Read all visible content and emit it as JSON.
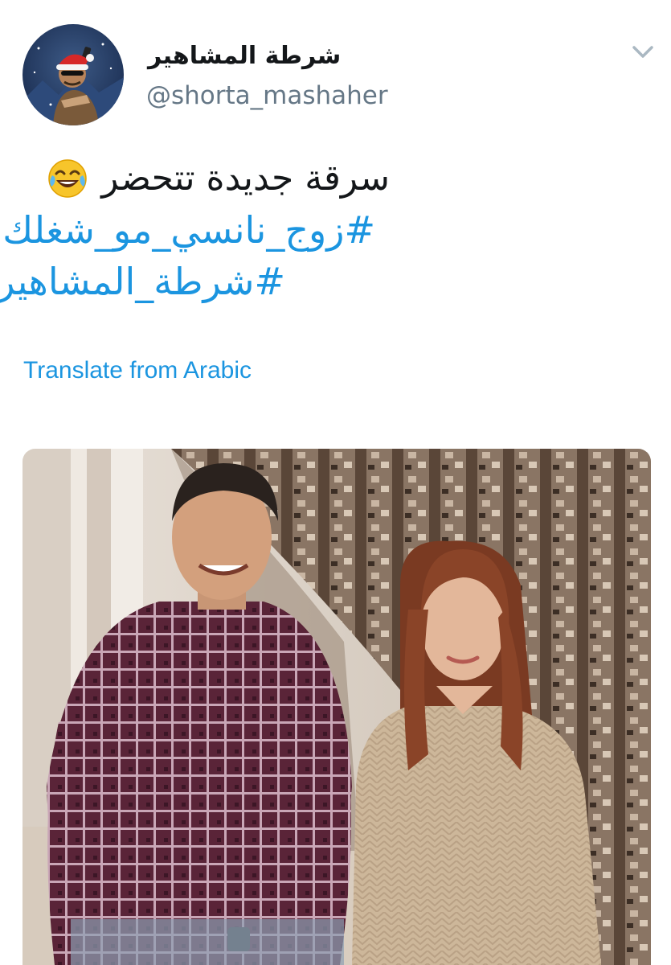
{
  "tweet": {
    "display_name": "شرطة المشاهير",
    "username": "@shorta_mashaher",
    "text": "سرقة جديدة تتحضر",
    "emoji": "face-with-tears-of-joy",
    "hashtags": [
      "#زوج_نانسي_مو_شغلك",
      "#شرطة_المشاهير"
    ],
    "translate_label": "Translate from Arabic"
  },
  "icons": {
    "menu": "chevron-down-icon",
    "avatar": "santa-hat-avatar"
  },
  "colors": {
    "link": "#1b95e0",
    "secondary_text": "#657786",
    "primary_text": "#14171a"
  }
}
